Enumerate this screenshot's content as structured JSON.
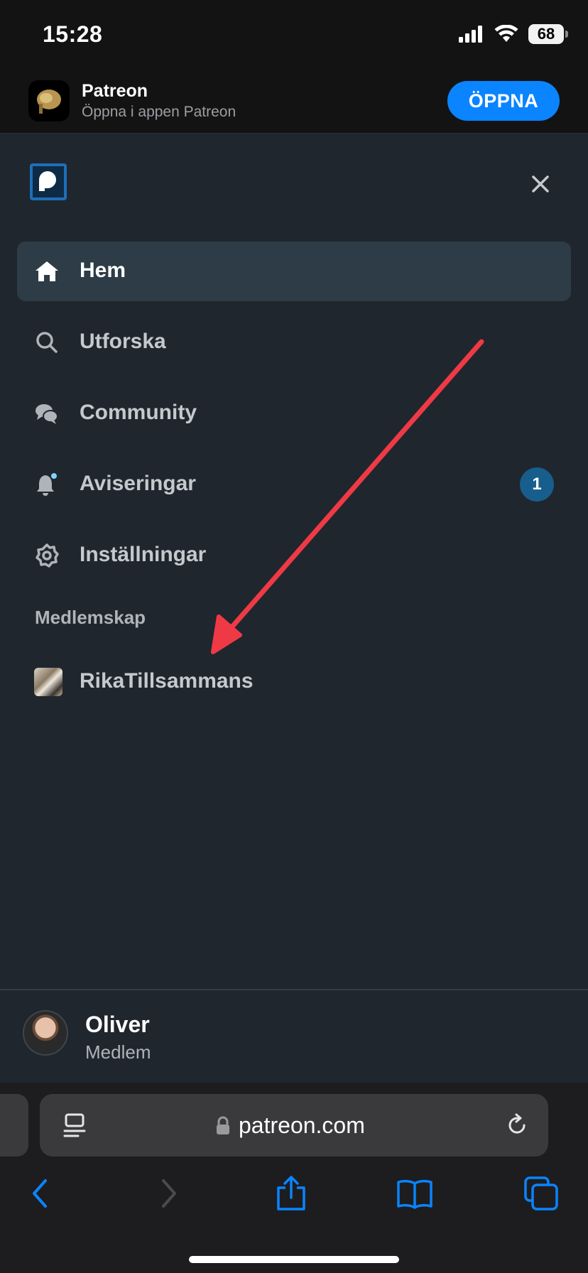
{
  "status_bar": {
    "time": "15:28",
    "battery": "68"
  },
  "banner": {
    "app_name": "Patreon",
    "subtitle": "Öppna i appen Patreon",
    "open_label": "ÖPPNA"
  },
  "nav": {
    "items": [
      {
        "label": "Hem",
        "icon": "home-icon",
        "active": true
      },
      {
        "label": "Utforska",
        "icon": "search-icon"
      },
      {
        "label": "Community",
        "icon": "chat-bubbles-icon"
      },
      {
        "label": "Aviseringar",
        "icon": "bell-icon",
        "badge": "1"
      },
      {
        "label": "Inställningar",
        "icon": "gear-icon"
      }
    ],
    "section_label": "Medlemskap",
    "membership": "RikaTillsammans"
  },
  "profile": {
    "name": "Oliver",
    "role": "Medlem"
  },
  "safari": {
    "url": "patreon.com"
  },
  "colors": {
    "accent": "#0a84ff",
    "panel_bg": "#20262d",
    "active_row": "#2d3c46",
    "badge": "#175e8c",
    "annotation_arrow": "#ef3a46"
  }
}
